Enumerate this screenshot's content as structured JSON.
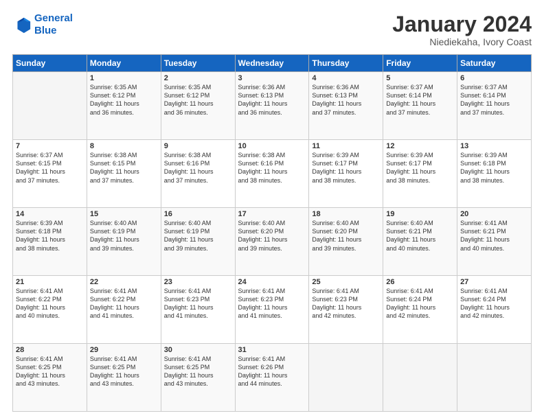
{
  "logo": {
    "line1": "General",
    "line2": "Blue"
  },
  "title": "January 2024",
  "location": "Niediekaha, Ivory Coast",
  "days_header": [
    "Sunday",
    "Monday",
    "Tuesday",
    "Wednesday",
    "Thursday",
    "Friday",
    "Saturday"
  ],
  "weeks": [
    [
      {
        "day": "",
        "content": ""
      },
      {
        "day": "1",
        "content": "Sunrise: 6:35 AM\nSunset: 6:12 PM\nDaylight: 11 hours\nand 36 minutes."
      },
      {
        "day": "2",
        "content": "Sunrise: 6:35 AM\nSunset: 6:12 PM\nDaylight: 11 hours\nand 36 minutes."
      },
      {
        "day": "3",
        "content": "Sunrise: 6:36 AM\nSunset: 6:13 PM\nDaylight: 11 hours\nand 36 minutes."
      },
      {
        "day": "4",
        "content": "Sunrise: 6:36 AM\nSunset: 6:13 PM\nDaylight: 11 hours\nand 37 minutes."
      },
      {
        "day": "5",
        "content": "Sunrise: 6:37 AM\nSunset: 6:14 PM\nDaylight: 11 hours\nand 37 minutes."
      },
      {
        "day": "6",
        "content": "Sunrise: 6:37 AM\nSunset: 6:14 PM\nDaylight: 11 hours\nand 37 minutes."
      }
    ],
    [
      {
        "day": "7",
        "content": "Sunrise: 6:37 AM\nSunset: 6:15 PM\nDaylight: 11 hours\nand 37 minutes."
      },
      {
        "day": "8",
        "content": "Sunrise: 6:38 AM\nSunset: 6:15 PM\nDaylight: 11 hours\nand 37 minutes."
      },
      {
        "day": "9",
        "content": "Sunrise: 6:38 AM\nSunset: 6:16 PM\nDaylight: 11 hours\nand 37 minutes."
      },
      {
        "day": "10",
        "content": "Sunrise: 6:38 AM\nSunset: 6:16 PM\nDaylight: 11 hours\nand 38 minutes."
      },
      {
        "day": "11",
        "content": "Sunrise: 6:39 AM\nSunset: 6:17 PM\nDaylight: 11 hours\nand 38 minutes."
      },
      {
        "day": "12",
        "content": "Sunrise: 6:39 AM\nSunset: 6:17 PM\nDaylight: 11 hours\nand 38 minutes."
      },
      {
        "day": "13",
        "content": "Sunrise: 6:39 AM\nSunset: 6:18 PM\nDaylight: 11 hours\nand 38 minutes."
      }
    ],
    [
      {
        "day": "14",
        "content": "Sunrise: 6:39 AM\nSunset: 6:18 PM\nDaylight: 11 hours\nand 38 minutes."
      },
      {
        "day": "15",
        "content": "Sunrise: 6:40 AM\nSunset: 6:19 PM\nDaylight: 11 hours\nand 39 minutes."
      },
      {
        "day": "16",
        "content": "Sunrise: 6:40 AM\nSunset: 6:19 PM\nDaylight: 11 hours\nand 39 minutes."
      },
      {
        "day": "17",
        "content": "Sunrise: 6:40 AM\nSunset: 6:20 PM\nDaylight: 11 hours\nand 39 minutes."
      },
      {
        "day": "18",
        "content": "Sunrise: 6:40 AM\nSunset: 6:20 PM\nDaylight: 11 hours\nand 39 minutes."
      },
      {
        "day": "19",
        "content": "Sunrise: 6:40 AM\nSunset: 6:21 PM\nDaylight: 11 hours\nand 40 minutes."
      },
      {
        "day": "20",
        "content": "Sunrise: 6:41 AM\nSunset: 6:21 PM\nDaylight: 11 hours\nand 40 minutes."
      }
    ],
    [
      {
        "day": "21",
        "content": "Sunrise: 6:41 AM\nSunset: 6:22 PM\nDaylight: 11 hours\nand 40 minutes."
      },
      {
        "day": "22",
        "content": "Sunrise: 6:41 AM\nSunset: 6:22 PM\nDaylight: 11 hours\nand 41 minutes."
      },
      {
        "day": "23",
        "content": "Sunrise: 6:41 AM\nSunset: 6:23 PM\nDaylight: 11 hours\nand 41 minutes."
      },
      {
        "day": "24",
        "content": "Sunrise: 6:41 AM\nSunset: 6:23 PM\nDaylight: 11 hours\nand 41 minutes."
      },
      {
        "day": "25",
        "content": "Sunrise: 6:41 AM\nSunset: 6:23 PM\nDaylight: 11 hours\nand 42 minutes."
      },
      {
        "day": "26",
        "content": "Sunrise: 6:41 AM\nSunset: 6:24 PM\nDaylight: 11 hours\nand 42 minutes."
      },
      {
        "day": "27",
        "content": "Sunrise: 6:41 AM\nSunset: 6:24 PM\nDaylight: 11 hours\nand 42 minutes."
      }
    ],
    [
      {
        "day": "28",
        "content": "Sunrise: 6:41 AM\nSunset: 6:25 PM\nDaylight: 11 hours\nand 43 minutes."
      },
      {
        "day": "29",
        "content": "Sunrise: 6:41 AM\nSunset: 6:25 PM\nDaylight: 11 hours\nand 43 minutes."
      },
      {
        "day": "30",
        "content": "Sunrise: 6:41 AM\nSunset: 6:25 PM\nDaylight: 11 hours\nand 43 minutes."
      },
      {
        "day": "31",
        "content": "Sunrise: 6:41 AM\nSunset: 6:26 PM\nDaylight: 11 hours\nand 44 minutes."
      },
      {
        "day": "",
        "content": ""
      },
      {
        "day": "",
        "content": ""
      },
      {
        "day": "",
        "content": ""
      }
    ]
  ]
}
